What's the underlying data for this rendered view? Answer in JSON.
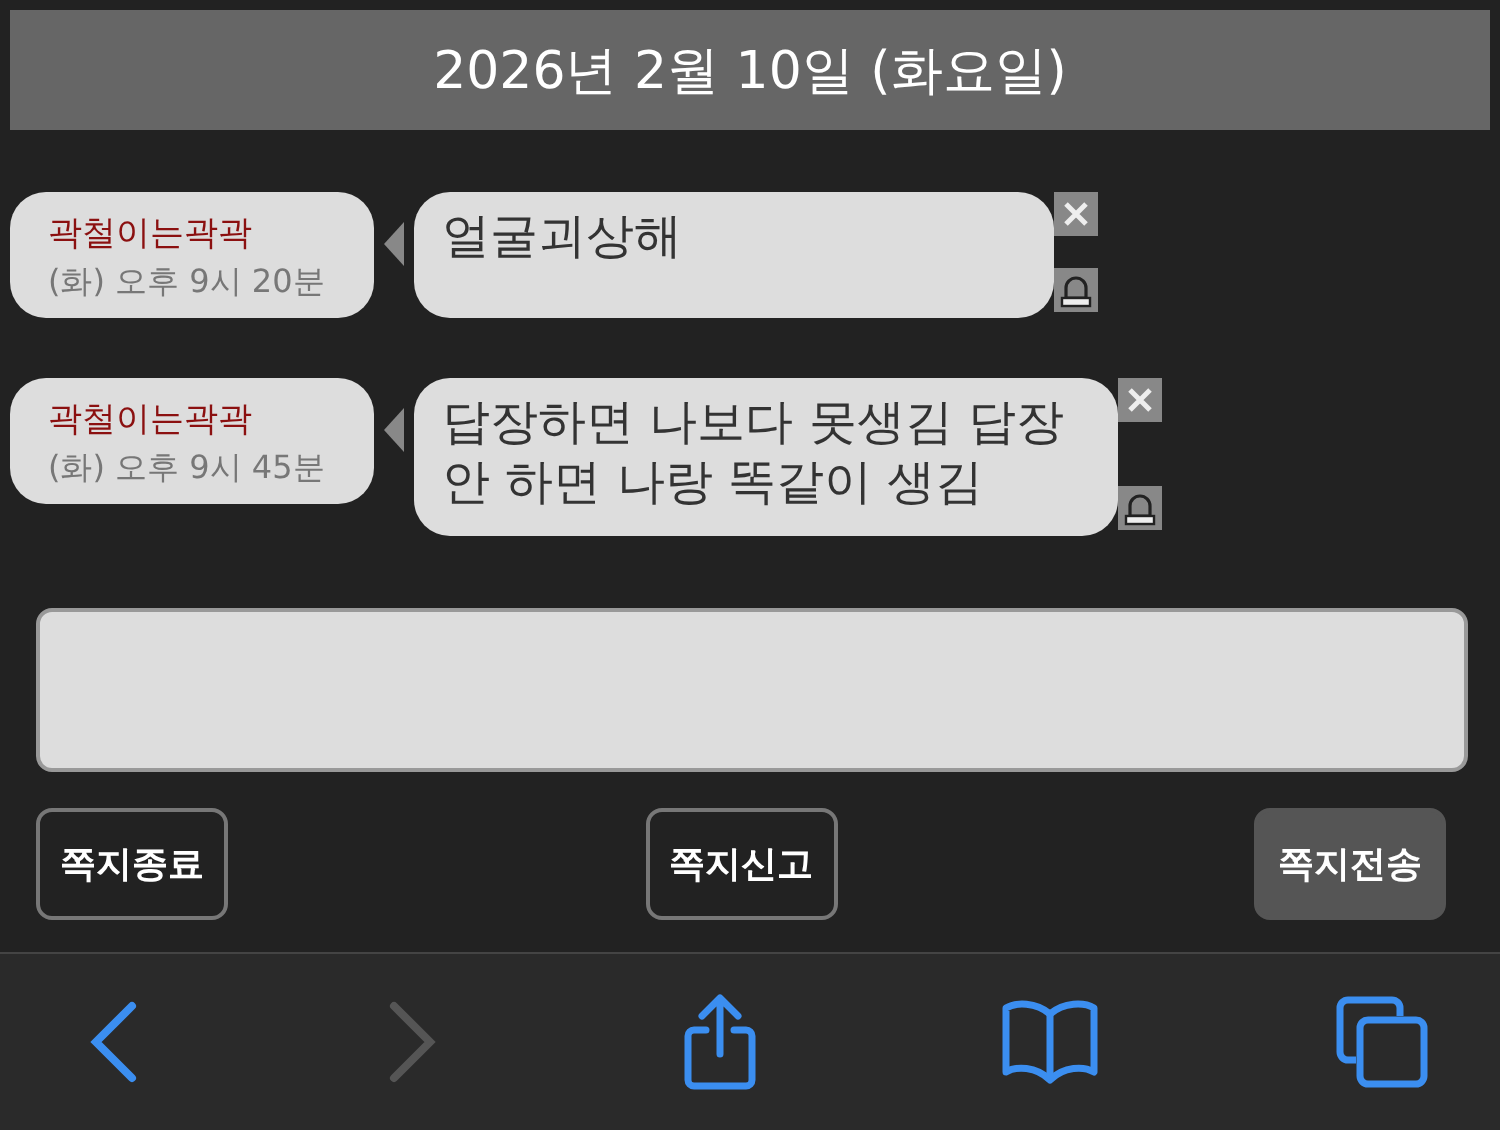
{
  "header": {
    "title": "2026년 2월 10일 (화요일)"
  },
  "messages": [
    {
      "sender": "곽철이는곽곽",
      "time": "(화) 오후 9시 20분",
      "text": "얼굴괴상해"
    },
    {
      "sender": "곽철이는곽곽",
      "time": "(화) 오후 9시 45분",
      "text": "답장하면 나보다 못생김 답장 안 하면 나랑 똑같이 생김"
    }
  ],
  "compose": {
    "kind": "textarea"
  },
  "buttons": [
    {
      "label": "쪽지종료",
      "kind": "outline"
    },
    {
      "label": "쪽지신고",
      "kind": "outline"
    },
    {
      "label": "쪽지전송",
      "kind": "filled"
    }
  ],
  "browser_toolbar": [
    {
      "kind": "back",
      "disabled": false
    },
    {
      "kind": "forward",
      "disabled": true
    },
    {
      "kind": "share",
      "disabled": false
    },
    {
      "kind": "bookmarks",
      "disabled": false
    },
    {
      "kind": "tabs",
      "disabled": false
    }
  ]
}
